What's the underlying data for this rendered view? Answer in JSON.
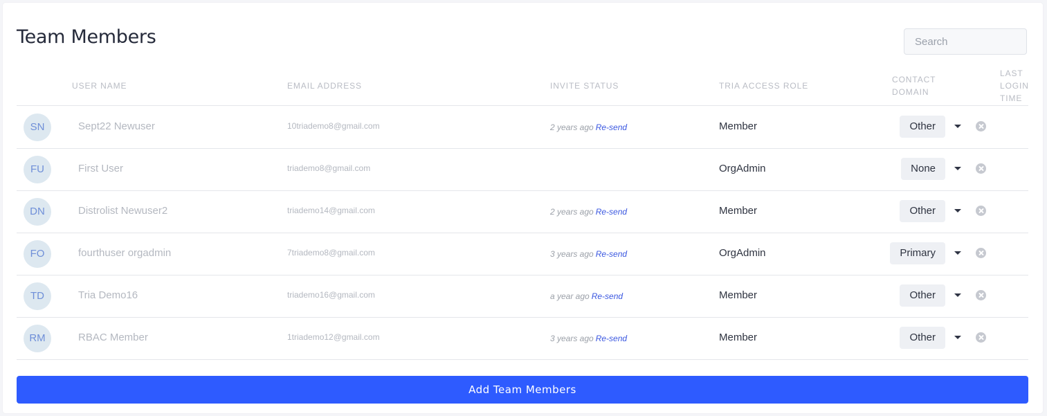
{
  "title": "Team Members",
  "search": {
    "placeholder": "Search",
    "value": ""
  },
  "columns": {
    "user_name": "USER NAME",
    "email": "EMAIL ADDRESS",
    "invite_status": "INVITE STATUS",
    "role": "TRIA ACCESS ROLE",
    "contact_domain": [
      "CONTACT",
      "DOMAIN"
    ],
    "last_login": [
      "LAST",
      "LOGIN",
      "TIME"
    ]
  },
  "rows": [
    {
      "initials": "SN",
      "name": "Sept22 Newuser",
      "email": "10triademo8@gmail.com",
      "invite_ago": "2 years ago",
      "resend": "Re-send",
      "role": "Member",
      "domain": "Other"
    },
    {
      "initials": "FU",
      "name": "First User",
      "email": "triademo8@gmail.com",
      "invite_ago": "",
      "resend": "",
      "role": "OrgAdmin",
      "domain": "None"
    },
    {
      "initials": "DN",
      "name": "Distrolist Newuser2",
      "email": "triademo14@gmail.com",
      "invite_ago": "2 years ago",
      "resend": "Re-send",
      "role": "Member",
      "domain": "Other"
    },
    {
      "initials": "FO",
      "name": "fourthuser orgadmin",
      "email": "7triademo8@gmail.com",
      "invite_ago": "3 years ago",
      "resend": "Re-send",
      "role": "OrgAdmin",
      "domain": "Primary"
    },
    {
      "initials": "TD",
      "name": "Tria Demo16",
      "email": "triademo16@gmail.com",
      "invite_ago": "a year ago",
      "resend": "Re-send",
      "role": "Member",
      "domain": "Other"
    },
    {
      "initials": "RM",
      "name": "RBAC Member",
      "email": "1triademo12@gmail.com",
      "invite_ago": "3 years ago",
      "resend": "Re-send",
      "role": "Member",
      "domain": "Other"
    }
  ],
  "add_button": "Add Team Members",
  "colors": {
    "accent": "#2e5bff",
    "link": "#3a57e0",
    "avatar_bg": "#dde8f0"
  },
  "icons": {
    "row_dropdown": "caret-down-icon",
    "row_remove": "remove-circle-icon"
  }
}
